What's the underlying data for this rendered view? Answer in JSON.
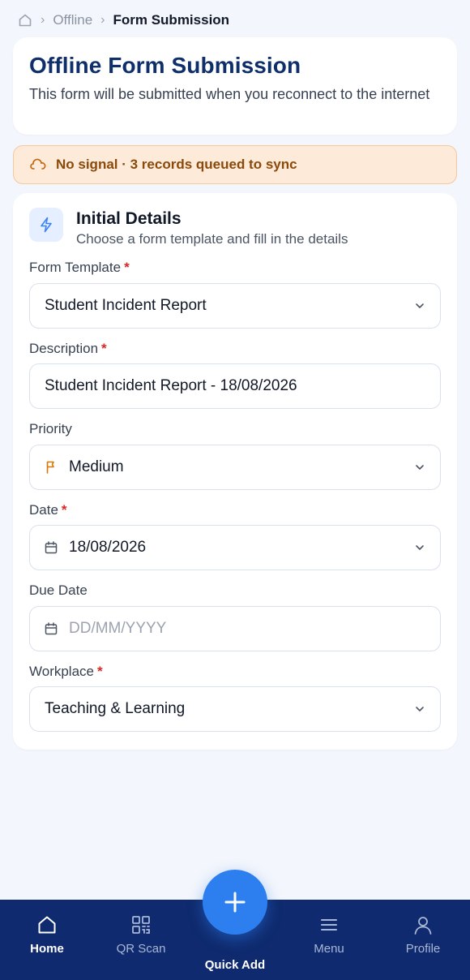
{
  "breadcrumb": {
    "items": [
      "Offline",
      "Form Submission"
    ]
  },
  "header": {
    "title": "Offline Form Submission",
    "subtitle": "This form will be submitted when you reconnect to the internet"
  },
  "alert": {
    "text": "No signal · 3 records queued to sync",
    "color": "#8a4a0b",
    "background": "#fdead8"
  },
  "section": {
    "title": "Initial Details",
    "subtitle": "Choose a form template and fill in the details"
  },
  "form": {
    "template": {
      "label": "Form Template",
      "required": "*",
      "value": "Student Incident Report"
    },
    "description": {
      "label": "Description",
      "required": "*",
      "value": "Student Incident Report - 18/08/2026"
    },
    "priority": {
      "label": "Priority",
      "value": "Medium",
      "icon": "flag-icon"
    },
    "date": {
      "label": "Date",
      "required": "*",
      "value": "18/08/2026",
      "icon": "calendar-icon"
    },
    "due_date": {
      "label": "Due Date",
      "placeholder": "DD/MM/YYYY",
      "icon": "calendar-icon"
    },
    "workplace": {
      "label": "Workplace",
      "required": "*",
      "value": "Teaching & Learning"
    }
  },
  "nav": {
    "items": [
      {
        "label": "Home",
        "icon": "home-icon",
        "active": true
      },
      {
        "label": "QR Scan",
        "icon": "qr-icon"
      },
      {
        "label": "Menu",
        "icon": "menu-icon"
      },
      {
        "label": "Profile",
        "icon": "profile-icon"
      }
    ],
    "fab_label": "Quick Add"
  },
  "colors": {
    "brand": "#0f2f6b",
    "nav_background": "#0f2a6e",
    "fab": "#2d7ff0",
    "required": "#dc2626"
  }
}
